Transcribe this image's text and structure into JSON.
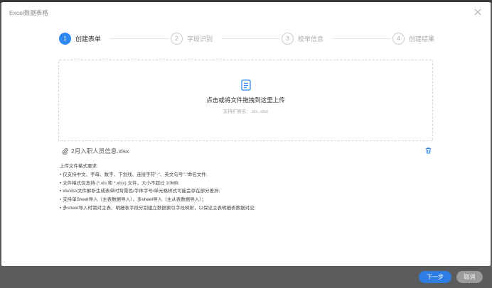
{
  "dialog": {
    "title": "Excel数据表格",
    "close_icon": "close-icon"
  },
  "steps": [
    {
      "number": "1",
      "label": "创建表单",
      "active": true
    },
    {
      "number": "2",
      "label": "字段识别",
      "active": false
    },
    {
      "number": "3",
      "label": "校举信息",
      "active": false
    },
    {
      "number": "4",
      "label": "创建结果",
      "active": false
    }
  ],
  "upload": {
    "icon": "document-icon",
    "text": "点击或将文件拖拽到这里上传",
    "hint": "支持扩展名：.xls,.xlsx"
  },
  "file": {
    "icon": "paperclip-icon",
    "name": "2月入职人员信息.xlsx",
    "delete_icon": "trash-icon"
  },
  "requirements": {
    "title": "上传文件格式要求:",
    "items": [
      "• 仅支持中文、字母、数字、下划线、连接字符\"-\"、英文句号\".\"命名文件;",
      "• 文件格式仅支持 (*.xls 和 *.xlsx) 文件，大小不超过 10MB;",
      "• xls/xlsx文件解析生成表单时背景色/字体字号/单元格样式可能会存在部分差异;",
      "• 支持单Sheet导入（主表数据导入），多sheet导入（主从表数据导入）；",
      "• 多sheet导入时需对主表、明细表字段分别建立数据索引字段映射，以保证主表明细表数据对应;"
    ]
  },
  "footer": {
    "next_label": "下一步",
    "cancel_label": "取消"
  },
  "colors": {
    "accent": "#2f87f0",
    "cancel": "#9b9b9b",
    "overlay": "#5a5a5a"
  }
}
